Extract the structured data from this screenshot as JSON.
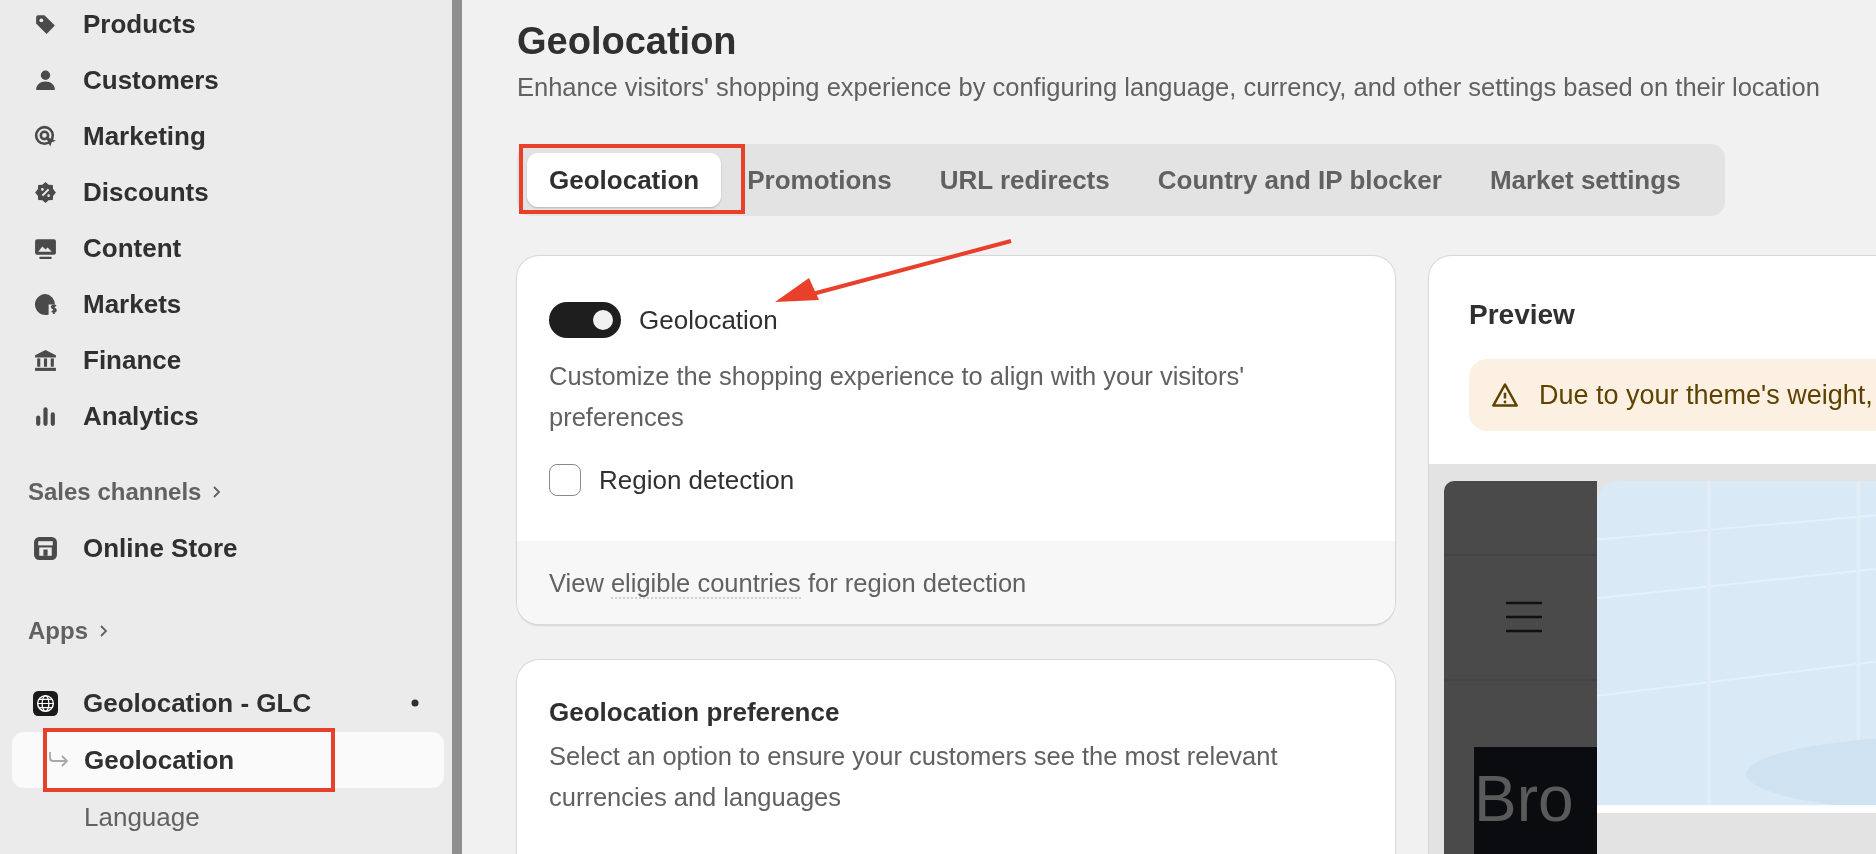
{
  "sidebar": {
    "items": [
      {
        "label": "Products"
      },
      {
        "label": "Customers"
      },
      {
        "label": "Marketing"
      },
      {
        "label": "Discounts"
      },
      {
        "label": "Content"
      },
      {
        "label": "Markets"
      },
      {
        "label": "Finance"
      },
      {
        "label": "Analytics"
      }
    ],
    "sales_channels": {
      "label": "Sales channels",
      "items": [
        {
          "label": "Online Store"
        }
      ]
    },
    "apps": {
      "label": "Apps",
      "app": {
        "name": "Geolocation - GLC",
        "children": [
          {
            "label": "Geolocation",
            "selected": true
          },
          {
            "label": "Language",
            "selected": false
          }
        ]
      }
    }
  },
  "page": {
    "title": "Geolocation",
    "subtitle": "Enhance visitors' shopping experience by configuring language, currency, and other settings based on their location"
  },
  "tabs": [
    {
      "label": "Geolocation",
      "selected": true
    },
    {
      "label": "Promotions",
      "selected": false
    },
    {
      "label": "URL redirects",
      "selected": false
    },
    {
      "label": "Country and IP blocker",
      "selected": false
    },
    {
      "label": "Market settings",
      "selected": false
    }
  ],
  "geolocation_card": {
    "toggle": {
      "label": "Geolocation",
      "on": true
    },
    "description": "Customize the shopping experience to align with your visitors' preferences",
    "checkbox": {
      "label": "Region detection",
      "checked": false
    },
    "footer": {
      "before": "View ",
      "link": "eligible countries",
      "after": " for region detection"
    }
  },
  "preference_card": {
    "title": "Geolocation preference",
    "description": "Select an option to ensure your customers see the most relevant currencies and languages"
  },
  "preview": {
    "title": "Preview",
    "warning": "Due to your theme's weight,",
    "store": {
      "hero_text": "Bro"
    }
  }
}
